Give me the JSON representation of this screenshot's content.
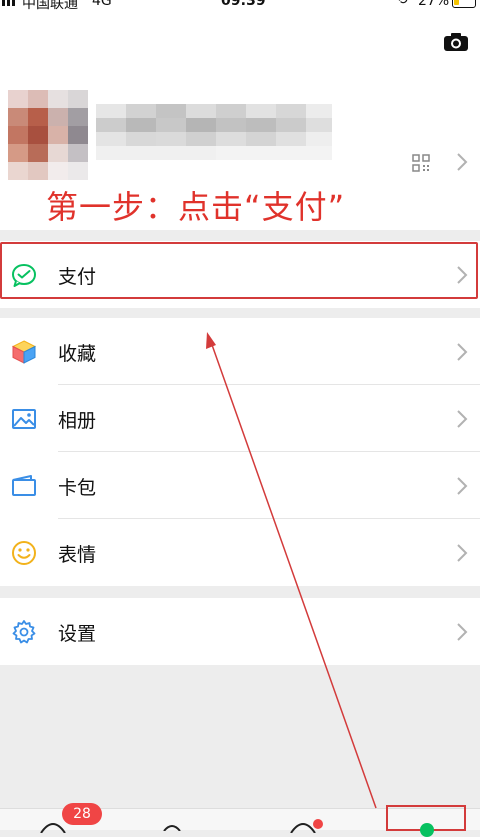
{
  "status_bar": {
    "carrier": "中国联通",
    "network": "4G",
    "time": "09:39",
    "battery": "27%"
  },
  "profile": {
    "annotation": "第一步：点击“支付”"
  },
  "menu": {
    "pay": "支付",
    "favorites": "收藏",
    "album": "相册",
    "cards": "卡包",
    "stickers": "表情",
    "settings": "设置"
  },
  "tabbar": {
    "chats_badge": "28"
  },
  "colors": {
    "annotation_red": "#e0322b",
    "wechat_green": "#07c160",
    "badge_red": "#f04545"
  }
}
